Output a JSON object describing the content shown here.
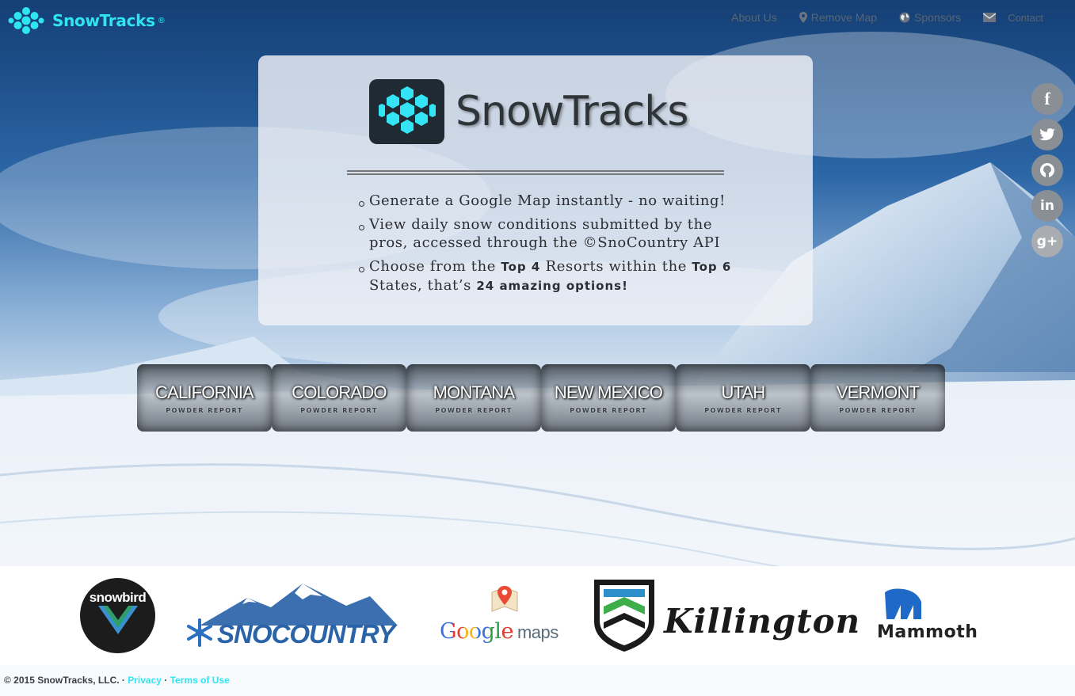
{
  "brand": {
    "name": "SnowTracks",
    "mark": "®",
    "icon": "snowflake-hex-icon",
    "color": "#2ee6f0"
  },
  "nav": {
    "about": "About Us",
    "remove_map": "Remove Map",
    "sponsors": "Sponsors",
    "contact": "Contact",
    "icons": {
      "remove_map": "map-marker-icon",
      "sponsors": "globe-icon",
      "contact": "envelope-icon"
    }
  },
  "hero": {
    "title": "SnowTracks",
    "bullet1": "Generate a Google Map instantly - no waiting!",
    "bullet2": "View daily snow conditions submitted by the pros, accessed through the ©SnoCountry API",
    "bullet3_a": "Choose from the ",
    "bullet3_b": "Top 4",
    "bullet3_c": " Resorts within the ",
    "bullet3_d": "Top 6",
    "bullet3_e": " States, that’s ",
    "bullet3_f": "24 amazing options!"
  },
  "social": {
    "facebook": "f",
    "twitter": "t",
    "github": "gh",
    "linkedin": "in",
    "googleplus": "g+"
  },
  "states": [
    {
      "name": "CALIFORNIA",
      "sub": "POWDER REPORT"
    },
    {
      "name": "COLORADO",
      "sub": "POWDER REPORT"
    },
    {
      "name": "MONTANA",
      "sub": "POWDER REPORT"
    },
    {
      "name": "NEW MEXICO",
      "sub": "POWDER REPORT"
    },
    {
      "name": "UTAH",
      "sub": "POWDER REPORT"
    },
    {
      "name": "VERMONT",
      "sub": "POWDER REPORT"
    }
  ],
  "sponsors": {
    "snowbird": "snowbird",
    "snocountry": "SNOCOUNTRY",
    "google_a": "Google",
    "google_b": "maps",
    "killington": "Killington",
    "mammoth": "Mammoth"
  },
  "footer": {
    "copyright": "© 2015 SnowTracks, LLC. · ",
    "privacy": "Privacy",
    "sep": " · ",
    "terms": "Terms of Use"
  }
}
